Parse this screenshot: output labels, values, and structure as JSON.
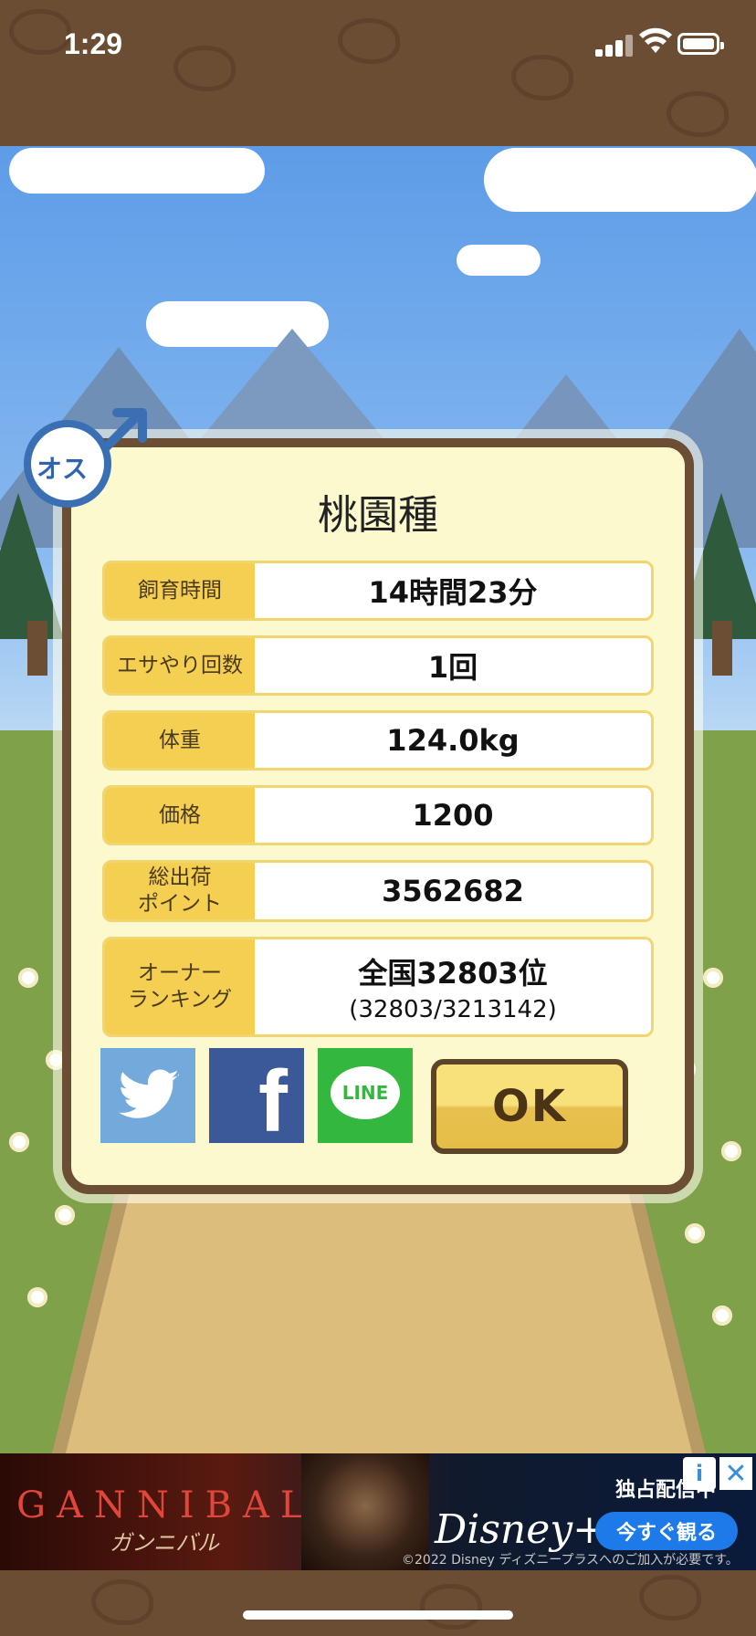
{
  "status_bar": {
    "time": "1:29"
  },
  "dialog": {
    "title": "桃園種",
    "gender_badge": "オス",
    "rows": [
      {
        "label": "飼育時間",
        "value": "14時間23分"
      },
      {
        "label": "エサやり回数",
        "value": "1回"
      },
      {
        "label": "体重",
        "value": "124.0kg"
      },
      {
        "label": "価格",
        "value": "1200"
      },
      {
        "label": "総出荷\nポイント",
        "value": "3562682"
      },
      {
        "label": "オーナー\nランキング",
        "value": "全国32803位",
        "sub": "(32803/3213142)"
      }
    ],
    "share": {
      "twitter": "twitter-icon",
      "facebook": "f",
      "line": "LINE"
    },
    "ok_label": "OK"
  },
  "ad": {
    "title": "GANNIBAL",
    "subtitle": "ガンニバル",
    "brand": "Disney+",
    "badge": "独占配信中",
    "cta": "今すぐ観る",
    "note": "©2022 Disney ディズニープラスへのご加入が必要です。",
    "info": "i",
    "close": "✕"
  },
  "colors": {
    "background": "#6a4d33",
    "dialog_bg": "#fdf9cf",
    "label_bg": "#f5cf52",
    "ok_button": "#f8e07b",
    "twitter": "#74a9dc",
    "facebook": "#3b5998",
    "line": "#34b73e"
  }
}
